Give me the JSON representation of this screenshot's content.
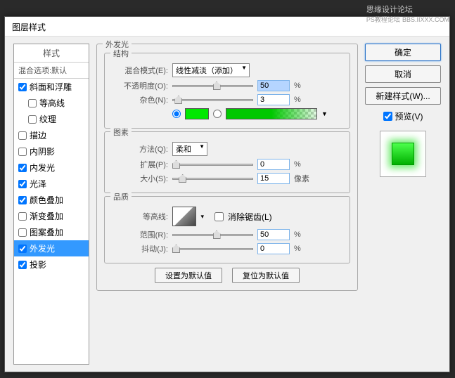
{
  "watermark": {
    "line1": "思缘设计论坛",
    "line2": "PS教程论坛",
    "url": "BBS.IIXXX.COM"
  },
  "dialog": {
    "title": "图层样式"
  },
  "styles": {
    "header": "样式",
    "subheader": "混合选项:默认",
    "items": [
      {
        "label": "斜面和浮雕",
        "checked": true,
        "indent": false
      },
      {
        "label": "等高线",
        "checked": false,
        "indent": true
      },
      {
        "label": "纹理",
        "checked": false,
        "indent": true
      },
      {
        "label": "描边",
        "checked": false,
        "indent": false
      },
      {
        "label": "内阴影",
        "checked": false,
        "indent": false
      },
      {
        "label": "内发光",
        "checked": true,
        "indent": false
      },
      {
        "label": "光泽",
        "checked": true,
        "indent": false
      },
      {
        "label": "颜色叠加",
        "checked": true,
        "indent": false
      },
      {
        "label": "渐变叠加",
        "checked": false,
        "indent": false
      },
      {
        "label": "图案叠加",
        "checked": false,
        "indent": false
      },
      {
        "label": "外发光",
        "checked": true,
        "indent": false,
        "selected": true
      },
      {
        "label": "投影",
        "checked": true,
        "indent": false
      }
    ]
  },
  "outerGlow": {
    "title": "外发光",
    "structure": {
      "title": "结构",
      "blendMode": {
        "label": "混合模式(E):",
        "value": "线性减淡（添加）"
      },
      "opacity": {
        "label": "不透明度(O):",
        "value": "50",
        "unit": "%",
        "pos": 50
      },
      "noise": {
        "label": "杂色(N):",
        "value": "3",
        "unit": "%",
        "pos": 3
      },
      "color": "#00e800"
    },
    "elements": {
      "title": "图素",
      "technique": {
        "label": "方法(Q):",
        "value": "柔和"
      },
      "spread": {
        "label": "扩展(P):",
        "value": "0",
        "unit": "%",
        "pos": 0
      },
      "size": {
        "label": "大小(S):",
        "value": "15",
        "unit": "像素",
        "pos": 8
      }
    },
    "quality": {
      "title": "品质",
      "contour": {
        "label": "等高线:",
        "antialias": "消除锯齿(L)"
      },
      "range": {
        "label": "范围(R):",
        "value": "50",
        "unit": "%",
        "pos": 50
      },
      "jitter": {
        "label": "抖动(J):",
        "value": "0",
        "unit": "%",
        "pos": 0
      }
    },
    "buttons": {
      "setDefault": "设置为默认值",
      "resetDefault": "复位为默认值"
    }
  },
  "right": {
    "ok": "确定",
    "cancel": "取消",
    "newStyle": "新建样式(W)...",
    "preview": "预览(V)"
  }
}
